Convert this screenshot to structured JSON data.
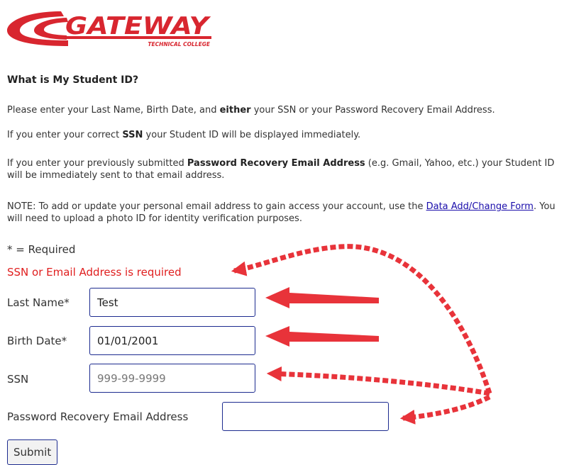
{
  "logo": {
    "wordmark": "GATEWAY",
    "subtitle": "TECHNICAL COLLEGE",
    "brand_color": "#d8262f"
  },
  "page": {
    "heading": "What is My Student ID?",
    "intro": {
      "before": "Please enter your Last Name, Birth Date, and ",
      "emphasis": "either",
      "after": " your SSN or your Password Recovery Email Address."
    },
    "ssn_note": {
      "before": "If you enter your correct ",
      "emphasis": "SSN",
      "after": " your Student ID will be displayed immediately."
    },
    "email_note": {
      "before": "If you enter your previously submitted ",
      "emphasis": "Password Recovery Email Address",
      "after": " (e.g. Gmail, Yahoo, etc.) your Student ID will be immediately sent to that email address."
    },
    "update_note": {
      "before": "NOTE: To add or update your personal email address to gain access your account, use the ",
      "link_text": "Data Add/Change Form",
      "after": ". You will need to upload a photo ID for identity verification purposes."
    }
  },
  "form": {
    "required_legend": "* = Required",
    "error_message": "SSN or Email Address is required",
    "error_color": "#e01e1e",
    "fields": {
      "last_name": {
        "label": "Last Name*",
        "value": "Test"
      },
      "birth_date": {
        "label": "Birth Date*",
        "value": "01/01/2001"
      },
      "ssn": {
        "label": "SSN",
        "value": "",
        "placeholder": "999-99-9999"
      },
      "email": {
        "label": "Password Recovery Email Address",
        "value": ""
      }
    },
    "submit_label": "Submit"
  },
  "annotation_color": "#e8333a"
}
